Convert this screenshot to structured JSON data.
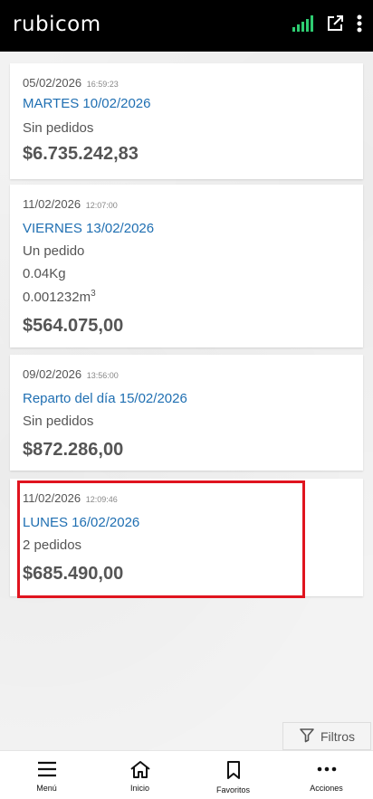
{
  "app": {
    "logo": "rubicom"
  },
  "top_icons": [
    "signal-icon",
    "external-link-icon",
    "kebab-menu-icon"
  ],
  "colors": {
    "accent": "#1f6fb2",
    "highlight": "#e0141e",
    "signal": "#2ecc71",
    "topbar": "#000000"
  },
  "cards": [
    {
      "date": "05/02/2026",
      "time": "16:59:23",
      "title": "MARTES 10/02/2026",
      "lines": [
        "Sin pedidos"
      ],
      "amount": "$6.735.242,83"
    },
    {
      "date": "11/02/2026",
      "time": "12:07:00",
      "title": "VIERNES 13/02/2026",
      "lines": [
        "Un pedido",
        "0.04Kg",
        "0.001232m"
      ],
      "volume_exponent": "3",
      "amount": "$564.075,00"
    },
    {
      "date": "09/02/2026",
      "time": "13:56:00",
      "title": "Reparto del día 15/02/2026",
      "lines": [
        "Sin pedidos"
      ],
      "amount": "$872.286,00"
    },
    {
      "date": "11/02/2026",
      "time": "12:09:46",
      "title": "LUNES 16/02/2026",
      "lines": [
        "2 pedidos"
      ],
      "amount": "$685.490,00"
    }
  ],
  "filter": {
    "label": "Filtros",
    "icon": "filter-icon"
  },
  "bottom_nav": [
    {
      "label": "Menú",
      "icon": "menu-icon"
    },
    {
      "label": "Inicio",
      "icon": "home-icon"
    },
    {
      "label": "Favoritos",
      "icon": "bookmark-icon"
    },
    {
      "label": "Acciones",
      "icon": "more-icon"
    }
  ]
}
